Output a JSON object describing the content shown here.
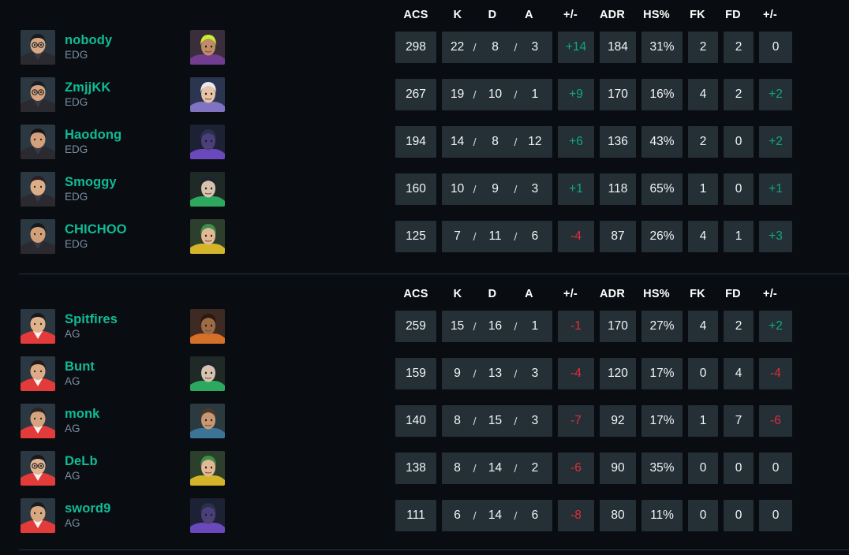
{
  "columns": {
    "acs": "ACS",
    "k": "K",
    "d": "D",
    "a": "A",
    "plusminus": "+/-",
    "adr": "ADR",
    "hs": "HS%",
    "fk": "FK",
    "fd": "FD",
    "fkfd_diff": "+/-"
  },
  "colors": {
    "accent_green": "#0fbc96",
    "positive": "#0fa884",
    "negative": "#e02d3c",
    "cell_bg": "#243036",
    "page_bg": "#090c11",
    "team_tag": "#7d8fa3"
  },
  "teams": [
    {
      "tag": "EDG",
      "players": [
        {
          "name": "nobody",
          "team": "EDG",
          "agent": "neon",
          "acs": "298",
          "k": "22",
          "d": "8",
          "a": "3",
          "kd_diff": "+14",
          "kd_diff_sign": "pos",
          "adr": "184",
          "hs": "31%",
          "fk": "2",
          "fd": "2",
          "fkfd_diff": "0",
          "fkfd_diff_sign": "zero"
        },
        {
          "name": "ZmjjKK",
          "team": "EDG",
          "agent": "jett",
          "acs": "267",
          "k": "19",
          "d": "10",
          "a": "1",
          "kd_diff": "+9",
          "kd_diff_sign": "pos",
          "adr": "170",
          "hs": "16%",
          "fk": "4",
          "fd": "2",
          "fkfd_diff": "+2",
          "fkfd_diff_sign": "pos"
        },
        {
          "name": "Haodong",
          "team": "EDG",
          "agent": "omen",
          "acs": "194",
          "k": "14",
          "d": "8",
          "a": "12",
          "kd_diff": "+6",
          "kd_diff_sign": "pos",
          "adr": "136",
          "hs": "43%",
          "fk": "2",
          "fd": "0",
          "fkfd_diff": "+2",
          "fkfd_diff_sign": "pos"
        },
        {
          "name": "Smoggy",
          "team": "EDG",
          "agent": "viper",
          "acs": "160",
          "k": "10",
          "d": "9",
          "a": "3",
          "kd_diff": "+1",
          "kd_diff_sign": "pos",
          "adr": "118",
          "hs": "65%",
          "fk": "1",
          "fd": "0",
          "fkfd_diff": "+1",
          "fkfd_diff_sign": "pos"
        },
        {
          "name": "CHICHOO",
          "team": "EDG",
          "agent": "killjoy",
          "acs": "125",
          "k": "7",
          "d": "11",
          "a": "6",
          "kd_diff": "-4",
          "kd_diff_sign": "neg",
          "adr": "87",
          "hs": "26%",
          "fk": "4",
          "fd": "1",
          "fkfd_diff": "+3",
          "fkfd_diff_sign": "pos"
        }
      ]
    },
    {
      "tag": "AG",
      "players": [
        {
          "name": "Spitfires",
          "team": "AG",
          "agent": "raze",
          "acs": "259",
          "k": "15",
          "d": "16",
          "a": "1",
          "kd_diff": "-1",
          "kd_diff_sign": "neg",
          "adr": "170",
          "hs": "27%",
          "fk": "4",
          "fd": "2",
          "fkfd_diff": "+2",
          "fkfd_diff_sign": "pos"
        },
        {
          "name": "Bunt",
          "team": "AG",
          "agent": "viper",
          "acs": "159",
          "k": "9",
          "d": "13",
          "a": "3",
          "kd_diff": "-4",
          "kd_diff_sign": "neg",
          "adr": "120",
          "hs": "17%",
          "fk": "0",
          "fd": "4",
          "fkfd_diff": "-4",
          "fkfd_diff_sign": "neg"
        },
        {
          "name": "monk",
          "team": "AG",
          "agent": "sova",
          "acs": "140",
          "k": "8",
          "d": "15",
          "a": "3",
          "kd_diff": "-7",
          "kd_diff_sign": "neg",
          "adr": "92",
          "hs": "17%",
          "fk": "1",
          "fd": "7",
          "fkfd_diff": "-6",
          "fkfd_diff_sign": "neg"
        },
        {
          "name": "DeLb",
          "team": "AG",
          "agent": "killjoy",
          "acs": "138",
          "k": "8",
          "d": "14",
          "a": "2",
          "kd_diff": "-6",
          "kd_diff_sign": "neg",
          "adr": "90",
          "hs": "35%",
          "fk": "0",
          "fd": "0",
          "fkfd_diff": "0",
          "fkfd_diff_sign": "zero"
        },
        {
          "name": "sword9",
          "team": "AG",
          "agent": "omen",
          "acs": "111",
          "k": "6",
          "d": "14",
          "a": "6",
          "kd_diff": "-8",
          "kd_diff_sign": "neg",
          "adr": "80",
          "hs": "11%",
          "fk": "0",
          "fd": "0",
          "fkfd_diff": "0",
          "fkfd_diff_sign": "zero"
        }
      ]
    }
  ]
}
